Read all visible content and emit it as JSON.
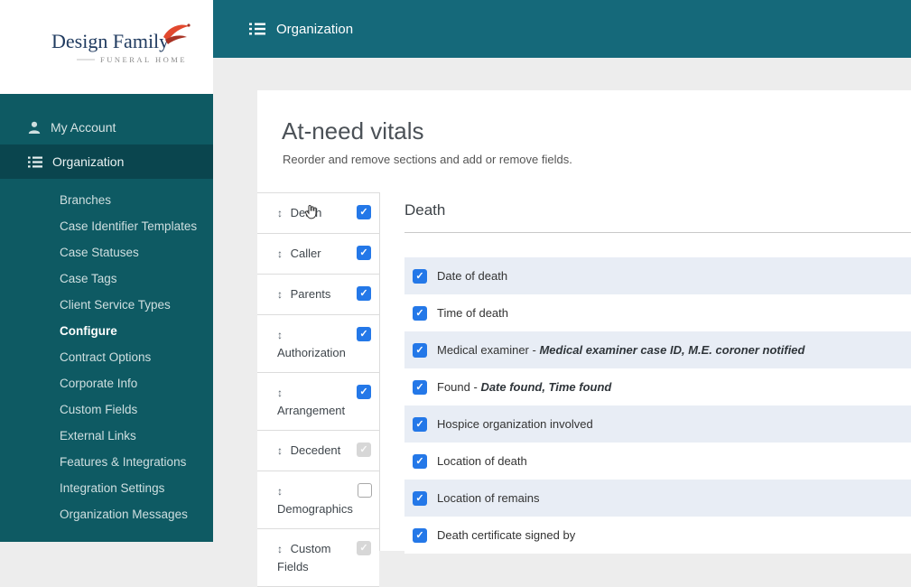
{
  "colors": {
    "sidebar": "#0e5a63",
    "sidebar_active": "#0a454e",
    "topbar": "#15697a",
    "checkbox_blue": "#2478e8",
    "row_stripe": "#e8edf5"
  },
  "logo": {
    "title": "Design Family",
    "subtitle": "FUNERAL HOME"
  },
  "topbar": {
    "title": "Organization"
  },
  "sidebar": {
    "account_label": "My Account",
    "organization_label": "Organization",
    "items": [
      {
        "label": "Branches",
        "active": false
      },
      {
        "label": "Case Identifier Templates",
        "active": false
      },
      {
        "label": "Case Statuses",
        "active": false
      },
      {
        "label": "Case Tags",
        "active": false
      },
      {
        "label": "Client Service Types",
        "active": false
      },
      {
        "label": "Configure",
        "active": true
      },
      {
        "label": "Contract Options",
        "active": false
      },
      {
        "label": "Corporate Info",
        "active": false
      },
      {
        "label": "Custom Fields",
        "active": false
      },
      {
        "label": "External Links",
        "active": false
      },
      {
        "label": "Features & Integrations",
        "active": false
      },
      {
        "label": "Integration Settings",
        "active": false
      },
      {
        "label": "Organization Messages",
        "active": false
      }
    ]
  },
  "main": {
    "title": "At-need vitals",
    "subtitle": "Reorder and remove sections and add or remove fields.",
    "sections": [
      {
        "label": "Death",
        "checked": true,
        "disabled": false,
        "selected": true
      },
      {
        "label": "Caller",
        "checked": true,
        "disabled": false,
        "selected": false
      },
      {
        "label": "Parents",
        "checked": true,
        "disabled": false,
        "selected": false
      },
      {
        "label": "Authorization",
        "checked": true,
        "disabled": false,
        "selected": false
      },
      {
        "label": "Arrangement",
        "checked": true,
        "disabled": false,
        "selected": false
      },
      {
        "label": "Decedent",
        "checked": true,
        "disabled": true,
        "selected": false
      },
      {
        "label": "Demographics",
        "checked": false,
        "disabled": false,
        "selected": false
      },
      {
        "label": "Custom Fields",
        "checked": true,
        "disabled": true,
        "selected": false
      }
    ],
    "fields_header": "Death",
    "fields": [
      {
        "label": "Date of death",
        "detail": "",
        "checked": true
      },
      {
        "label": "Time of death",
        "detail": "",
        "checked": true
      },
      {
        "label": "Medical examiner",
        "detail": "Medical examiner case ID, M.E. coroner notified",
        "checked": true
      },
      {
        "label": "Found",
        "detail": "Date found, Time found",
        "checked": true
      },
      {
        "label": "Hospice organization involved",
        "detail": "",
        "checked": true
      },
      {
        "label": "Location of death",
        "detail": "",
        "checked": true
      },
      {
        "label": "Location of remains",
        "detail": "",
        "checked": true
      },
      {
        "label": "Death certificate signed by",
        "detail": "",
        "checked": true
      }
    ]
  }
}
